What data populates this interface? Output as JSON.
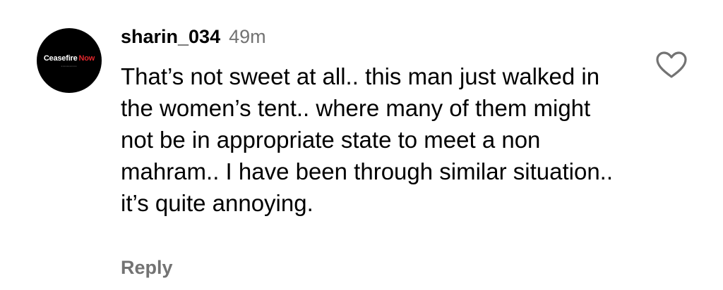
{
  "comment": {
    "avatar": {
      "logo_word_1": "Ceasefire",
      "logo_word_2": "Now",
      "logo_sub": "▪▪▪▪▪▪▪▪▪▪▪"
    },
    "username": "sharin_034",
    "timestamp": "49m",
    "text": "That’s not sweet at all.. this man just walked in the women’s tent.. where many of them might not be in appropriate state to meet a non mahram.. I have been through similar situation.. it’s quite annoying.",
    "reply_label": "Reply",
    "like_icon": "heart-outline-icon"
  },
  "colors": {
    "text": "#000000",
    "secondary": "#737373",
    "avatar_bg": "#000000",
    "avatar_accent": "#e0262c"
  }
}
